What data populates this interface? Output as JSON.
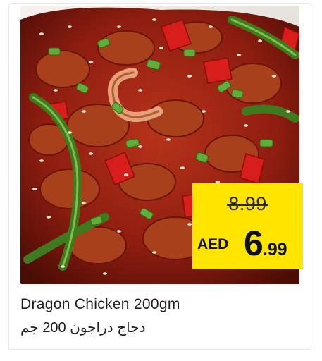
{
  "product": {
    "name_en": "Dragon Chicken 200gm",
    "name_ar": "دجاج دراجون 200 جم",
    "image_alt": "dragon-chicken-dish"
  },
  "price": {
    "old": "8.99",
    "currency": "AED",
    "new_integer": "6",
    "new_decimal": ".99"
  },
  "colors": {
    "tag_background": "#ffe400",
    "text": "#1e1e1e",
    "sauce": "#8e1d10",
    "pepper_red": "#d81e1a",
    "pepper_green": "#3f7a1f",
    "scallion": "#5fae3a"
  }
}
